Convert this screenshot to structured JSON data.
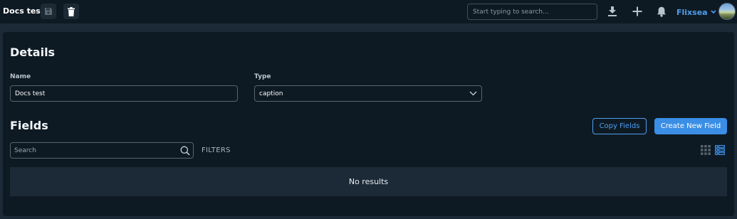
{
  "header": {
    "title": "Docs test",
    "search_placeholder": "Start typing to search...",
    "user_name": "Flixsea",
    "icons": [
      "save-icon",
      "trash-icon",
      "download-icon",
      "plus-icon",
      "bell-icon",
      "chevron-down-icon"
    ]
  },
  "details": {
    "heading": "Details",
    "name_label": "Name",
    "name_value": "Docs test",
    "type_label": "Type",
    "type_value": "caption"
  },
  "fields": {
    "heading": "Fields",
    "copy_label": "Copy Fields",
    "create_label": "Create New Field",
    "search_placeholder": "Search",
    "filters_label": "FILTERS",
    "empty_text": "No results"
  },
  "colors": {
    "accent": "#3a8ee6",
    "background": "#0e1a23",
    "panel_alt": "#1b2a36"
  }
}
